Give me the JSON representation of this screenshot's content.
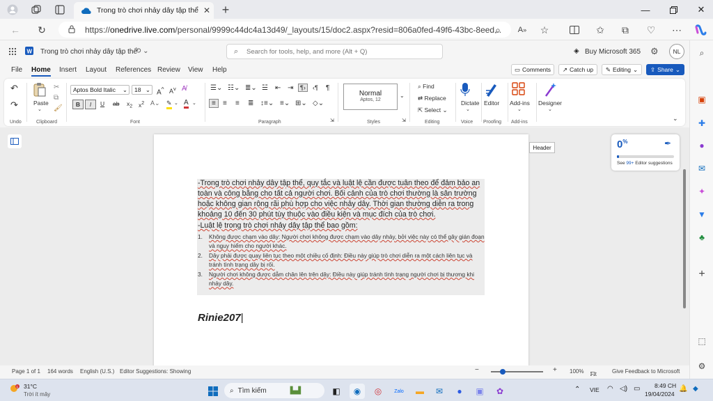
{
  "browser": {
    "tab_title": "Trong trò chơi nhảy dây tập thể, q",
    "url_prefix": "https://",
    "url_domain": "onedrive.live.com",
    "url_path": "/personal/9999c44dc4a13d49/_layouts/15/doc2.aspx?resid=806a0fed-49f6-43bc-8eed..."
  },
  "app": {
    "doc_title": "Trong trò chơi nhảy dây tập thể",
    "search_placeholder": "Search for tools, help, and more (Alt + Q)",
    "buy_label": "Buy Microsoft 365",
    "avatar_initials": "NL",
    "menus": [
      "File",
      "Home",
      "Insert",
      "Layout",
      "References",
      "Review",
      "View",
      "Help"
    ],
    "comments_label": "Comments",
    "catchup_label": "Catch up",
    "editing_label": "Editing",
    "share_label": "Share"
  },
  "ribbon": {
    "undo_label": "Undo",
    "clipboard_label": "Clipboard",
    "paste_label": "Paste",
    "font_name": "Aptos Bold Italic",
    "font_size": "18",
    "font_label": "Font",
    "paragraph_label": "Paragraph",
    "style_name": "Normal",
    "style_sub": "Aptos, 12",
    "styles_label": "Styles",
    "find_label": "Find",
    "replace_label": "Replace",
    "select_label": "Select",
    "editing_group_label": "Editing",
    "dictate_label": "Dictate",
    "voice_label": "Voice",
    "editor_label": "Editor",
    "proofing_label": "Proofing",
    "addins_label": "Add-ins",
    "addins_group_label": "Add-ins",
    "designer_label": "Designer"
  },
  "document": {
    "header_tooltip": "Header",
    "para1": "-Trong trò chơi nhảy dây tập thể, quy tắc và luật lệ cần được tuân theo để đảm bảo an toàn và công bằng cho tất cả người chơi. Bối cảnh của trò chơi thường là sân trường hoặc không gian rộng rãi phù hợp cho việc nhảy dây. Thời gian thường diễn ra trong khoảng 10 đến 30 phút tùy thuộc vào điều kiện và mục đích của trò chơi.",
    "para2": "-Luật lệ trong trò chơi nhảy dây tập thể bao gồm:",
    "list": [
      {
        "num": "1.",
        "text": "Không được chạm vào dây: Người chơi không được chạm vào dây nhảy, bởi việc này có thể gây gián đoạn và nguy hiểm cho người khác."
      },
      {
        "num": "2.",
        "text": "Dây phải được quay liên tục theo một chiều cố định: Điều này giúp trò chơi diễn ra một cách liên tục và tránh tình trạng dây bị rối."
      },
      {
        "num": "3.",
        "text": "Người chơi không được dẫm chân lên trên dây: Điều này giúp tránh tình trạng người chơi bị thương khi nhảy dây."
      }
    ],
    "signature": "Rinie207"
  },
  "editor_card": {
    "score": "0",
    "score_unit": "%",
    "suggestions_prefix": "See ",
    "suggestions_count": "99+",
    "suggestions_suffix": " Editor suggestions"
  },
  "status": {
    "page": "Page 1 of 1",
    "words": "164 words",
    "lang": "English (U.S.)",
    "editor": "Editor Suggestions: Showing",
    "zoom": "100%",
    "fit": "Fit",
    "feedback": "Give Feedback to Microsoft"
  },
  "taskbar": {
    "weather_temp": "31°C",
    "weather_desc": "Trời ít mây",
    "search_label": "Tìm kiếm",
    "lang": "VIE",
    "time": "8:49 CH",
    "date": "19/04/2024"
  },
  "colors": {
    "accent": "#185abd",
    "active_tab": "#f7f7f7",
    "page_bg": "#ececec"
  }
}
